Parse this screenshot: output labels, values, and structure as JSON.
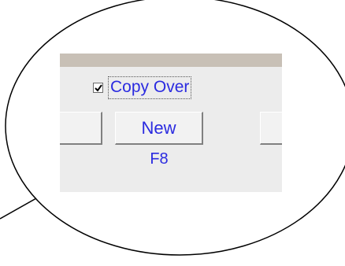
{
  "callout": {
    "checkbox": {
      "label": "Copy Over",
      "checked": true
    },
    "new_button": {
      "label": "New",
      "shortcut": "F8"
    }
  },
  "colors": {
    "text": "#2b2be0",
    "panel_bg": "#ececec",
    "title_strip": "#c8c0b6"
  }
}
